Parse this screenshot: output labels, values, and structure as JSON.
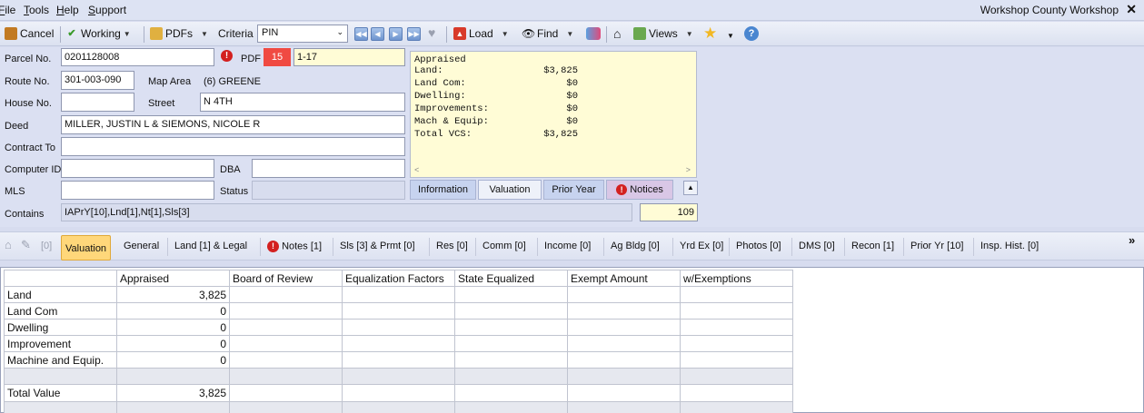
{
  "menu": [
    "File",
    "Tools",
    "Help",
    "Support"
  ],
  "window_title": "Workshop County Workshop",
  "toolbar": {
    "cancel": "Cancel",
    "working": "Working",
    "pdfs": "PDFs",
    "criteria_label": "Criteria",
    "criteria_value": "PIN",
    "load": "Load",
    "find": "Find",
    "views": "Views"
  },
  "form": {
    "parcel_label": "Parcel No.",
    "parcel_value": "0201128008",
    "pdf_label": "PDF",
    "pdf_badge": "15",
    "pdf_range": "1-17",
    "route_label": "Route No.",
    "route_value": "301-003-090",
    "map_area_label": "Map Area",
    "map_area_value": "(6) GREENE",
    "house_label": "House No.",
    "house_value": "",
    "street_label": "Street",
    "street_value": "N 4TH",
    "deed_label": "Deed",
    "deed_value": "MILLER, JUSTIN L & SIEMONS, NICOLE R",
    "contract_label": "Contract To",
    "contract_value": "",
    "computer_id_label": "Computer ID",
    "computer_id_value": "",
    "dba_label": "DBA",
    "dba_value": "",
    "mls_label": "MLS",
    "mls_value": "",
    "status_label": "Status",
    "status_value": "",
    "contains_label": "Contains",
    "contains_value": "IAPrY[10],Lnd[1],Nt[1],Sls[3]",
    "count_value": "109"
  },
  "valuation_box": {
    "title": "Appraised",
    "rows": [
      {
        "k": "Land:",
        "v": "$3,825"
      },
      {
        "k": "Land Com:",
        "v": "$0"
      },
      {
        "k": "Dwelling:",
        "v": "$0"
      },
      {
        "k": "Improvements:",
        "v": "$0"
      },
      {
        "k": "Mach & Equip:",
        "v": "$0"
      },
      {
        "k": "Total VCS:",
        "v": "$3,825"
      }
    ]
  },
  "mini_tabs": [
    "Information",
    "Valuation",
    "Prior Year",
    "Notices"
  ],
  "tabs": {
    "count_prefix": "[0]",
    "items": [
      "Valuation",
      "General",
      "Land [1] & Legal",
      "Notes [1]",
      "Sls [3] & Prmt [0]",
      "Res [0]",
      "Comm [0]",
      "Income [0]",
      "Ag Bldg [0]",
      "Yrd Ex [0]",
      "Photos [0]",
      "DMS [0]",
      "Recon [1]",
      "Prior Yr [10]",
      "Insp. Hist. [0]"
    ],
    "more": "»"
  },
  "grid": {
    "headers": [
      "",
      "Appraised",
      "Board of Review",
      "Equalization Factors",
      "State Equalized",
      "Exempt Amount",
      "w/Exemptions"
    ],
    "rows": [
      [
        "Land",
        "3,825"
      ],
      [
        "Land Com",
        "0"
      ],
      [
        "Dwelling",
        "0"
      ],
      [
        "Improvement",
        "0"
      ],
      [
        "Machine and Equip.",
        "0"
      ]
    ],
    "total_label": "Total Value",
    "total_value": "3,825"
  }
}
